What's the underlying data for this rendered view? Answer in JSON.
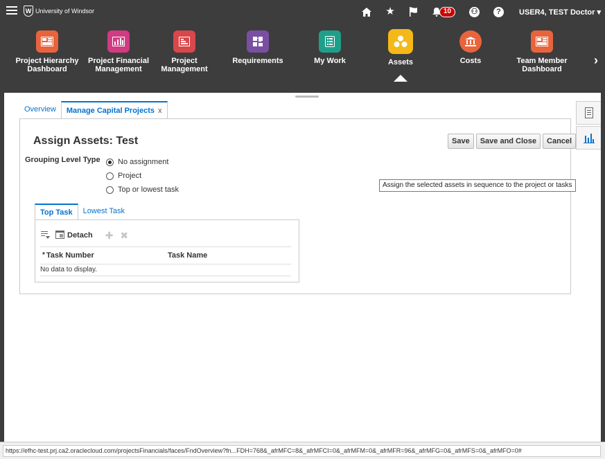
{
  "header": {
    "logo_text": "University of Windsor",
    "logo_mark": "W",
    "notification_count": "10",
    "user_name": "USER4, TEST Doctor"
  },
  "springboard": {
    "items": [
      {
        "label": "Project Hierarchy Dashboard",
        "color": "#e8643c",
        "icon": "dashboard-icon"
      },
      {
        "label": "Project Financial Management",
        "color": "#d13b82",
        "icon": "bar-chart-icon"
      },
      {
        "label": "Project Management",
        "color": "#d8474b",
        "icon": "gantt-icon"
      },
      {
        "label": "Requirements",
        "color": "#7a4fa3",
        "icon": "puzzle-icon"
      },
      {
        "label": "My Work",
        "color": "#1f9f8a",
        "icon": "checklist-icon"
      },
      {
        "label": "Assets",
        "color": "#f4b818",
        "icon": "assets-icon"
      },
      {
        "label": "Costs",
        "color": "#e8643c",
        "icon": "costs-icon"
      },
      {
        "label": "Team Member Dashboard",
        "color": "#e8643c",
        "icon": "dashboard-icon"
      }
    ]
  },
  "tabs": {
    "overview": "Overview",
    "manage": "Manage Capital Projects",
    "close": "x"
  },
  "page": {
    "title": "Assign Assets: Test",
    "save": "Save",
    "save_and_close": "Save and Close",
    "cancel": "Cancel",
    "grouping_label": "Grouping Level Type",
    "options": [
      "No assignment",
      "Project",
      "Top or lowest task"
    ],
    "tooltip": "Assign the selected assets in sequence to the project or tasks"
  },
  "subtabs": {
    "top_task": "Top Task",
    "lowest_task": "Lowest Task"
  },
  "table": {
    "detach": "Detach",
    "required_marker": "*",
    "columns": [
      "Task Number",
      "Task Name"
    ],
    "empty": "No data to display."
  },
  "status": {
    "url": "https://efhc-test.prj.ca2.oraclecloud.com/projectsFinancials/faces/FndOverview?fn...FDH=768&_afrMFC=8&_afrMFCI=0&_afrMFM=0&_afrMFR=96&_afrMFG=0&_afrMFS=0&_afrMFO=0#"
  },
  "colors": {
    "header_bg": "#3d3d3d",
    "accent": "#0572ce"
  }
}
